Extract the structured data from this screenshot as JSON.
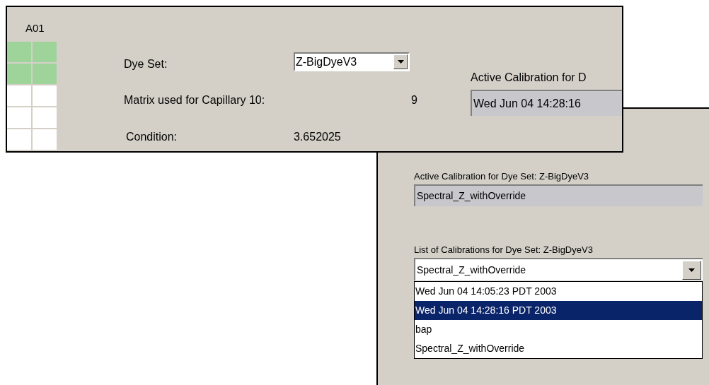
{
  "top_panel": {
    "well_label": "A01",
    "wells": [
      {
        "filled": true
      },
      {
        "filled": true
      },
      {
        "filled": true
      },
      {
        "filled": true
      },
      {
        "filled": false
      },
      {
        "filled": false
      },
      {
        "filled": false
      },
      {
        "filled": false
      },
      {
        "filled": false
      },
      {
        "filled": false
      }
    ],
    "dye_set_label": "Dye Set:",
    "dye_set_value": "Z-BigDyeV3",
    "matrix_label": "Matrix used for Capillary 10:",
    "matrix_value": "9",
    "condition_label": "Condition:",
    "condition_value": "3.652025",
    "active_label": "Active Calibration for D",
    "active_value": "Wed Jun 04 14:28:16"
  },
  "bottom_panel": {
    "active_label": "Active Calibration for Dye Set: Z-BigDyeV3",
    "active_value": "Spectral_Z_withOverride",
    "list_label": "List of Calibrations for Dye Set: Z-BigDyeV3",
    "list_value": "Spectral_Z_withOverride",
    "options": [
      {
        "label": "Wed Jun 04 14:05:23 PDT 2003",
        "selected": false
      },
      {
        "label": "Wed Jun 04 14:28:16 PDT 2003",
        "selected": true
      },
      {
        "label": "bap",
        "selected": false
      },
      {
        "label": "Spectral_Z_withOverride",
        "selected": false
      }
    ]
  }
}
